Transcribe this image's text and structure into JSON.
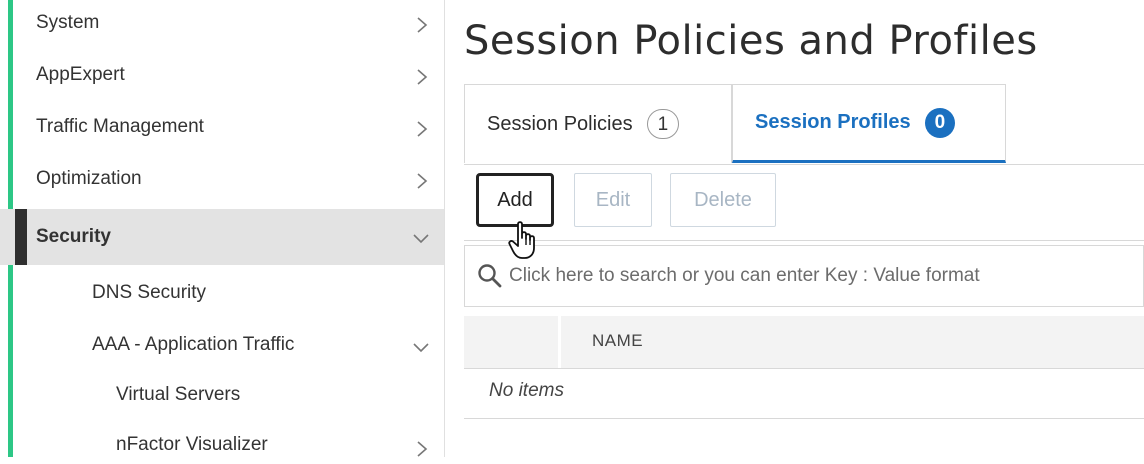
{
  "sidebar": {
    "items": [
      {
        "label": "System"
      },
      {
        "label": "AppExpert"
      },
      {
        "label": "Traffic Management"
      },
      {
        "label": "Optimization"
      },
      {
        "label": "Security"
      },
      {
        "label": "DNS Security"
      },
      {
        "label": "AAA - Application Traffic"
      },
      {
        "label": "Virtual Servers"
      },
      {
        "label": "nFactor Visualizer"
      }
    ]
  },
  "page": {
    "title": "Session Policies and Profiles"
  },
  "tabs": [
    {
      "label": "Session Policies",
      "count": "1",
      "active": false
    },
    {
      "label": "Session Profiles",
      "count": "0",
      "active": true
    }
  ],
  "toolbar": {
    "add_label": "Add",
    "edit_label": "Edit",
    "delete_label": "Delete"
  },
  "search": {
    "placeholder": "Click here to search or you can enter Key : Value format"
  },
  "table": {
    "columns": [
      "NAME"
    ],
    "empty_text": "No items"
  },
  "colors": {
    "accent": "#1b70c0",
    "sidebar_marker": "#2dc786"
  }
}
